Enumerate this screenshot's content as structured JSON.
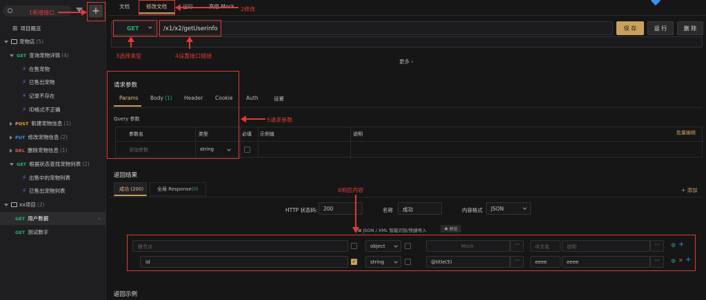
{
  "sidebar": {
    "overview": "项目概览",
    "folder1": {
      "name": "宠物店",
      "count": "(5)"
    },
    "api_get_detail": {
      "method": "GET",
      "name": "查询宠物详情",
      "count": "(4)"
    },
    "cases": [
      "在售宠物",
      "已售出宠物",
      "记录不存在",
      "ID格式不正确"
    ],
    "api_post": {
      "method": "POST",
      "name": "新建宠物信息",
      "count": "(1)"
    },
    "api_put": {
      "method": "PUT",
      "name": "修改宠物信息",
      "count": "(2)"
    },
    "api_del": {
      "method": "DEL",
      "name": "删除宠物信息",
      "count": "(1)"
    },
    "api_get_list": {
      "method": "GET",
      "name": "根据状态查找宠物列表",
      "count": "(2)"
    },
    "list_cases": [
      "出售中的宠物列表",
      "已售出宠物列表"
    ],
    "folder2": {
      "name": "xx项目",
      "count": "(2)"
    },
    "api_user": {
      "method": "GET",
      "name": "用户数据"
    },
    "api_test": {
      "method": "GET",
      "name": "测试数字"
    }
  },
  "tabs": {
    "doc": "文档",
    "edit": "修改文档",
    "run": "运行",
    "mock": "高级 Mock"
  },
  "request": {
    "method": "GET",
    "url": "/x1/x2/getUserinfo",
    "save": "保 存",
    "run": "运 行",
    "delete": "删 除",
    "more": "更多"
  },
  "params": {
    "title": "请求参数",
    "tabs": [
      "Params",
      "Body",
      "Header",
      "Cookie",
      "Auth",
      "设置"
    ],
    "body_count": "(1)",
    "query_label": "Query 参数",
    "columns": [
      "参数名",
      "类型",
      "必填",
      "示例值",
      "说明"
    ],
    "bulk_edit": "批量编辑",
    "add_placeholder": "添加参数",
    "type_value": "string"
  },
  "response": {
    "title": "返回结果",
    "tab_success": "成功 (200)",
    "tab_global": "全局 Response",
    "global_count": "(0)",
    "add": "+ 添加",
    "http_label": "HTTP 状态码:",
    "http_value": "200",
    "name_label": "名称",
    "name_value": "成功",
    "format_label": "内容格式",
    "format_value": "JSON",
    "smart_import": "JSON / XML 智能识别/快捷导入",
    "preview": "预览",
    "root_placeholder": "根节点",
    "root_type": "object",
    "mock_placeholder": "Mock",
    "cn_placeholder": "中文名",
    "desc_placeholder": "说明",
    "row_name": "id",
    "row_type": "string",
    "row_mock": "@title(5)",
    "row_cn": "eeee",
    "row_desc": "eeee",
    "example_title": "返回示例"
  },
  "annotations": {
    "a1": "1新增接口",
    "a2": "2修改",
    "a3": "3选择类型",
    "a4": "4设置接口链接",
    "a5": "5请求参数",
    "a6": "6响应内容"
  },
  "colors": {
    "get": "#26b373",
    "post": "#e9a23b",
    "put": "#3b8ff0",
    "del": "#e45a4d",
    "accent": "#c9a15c",
    "annotation": "#e53935"
  }
}
